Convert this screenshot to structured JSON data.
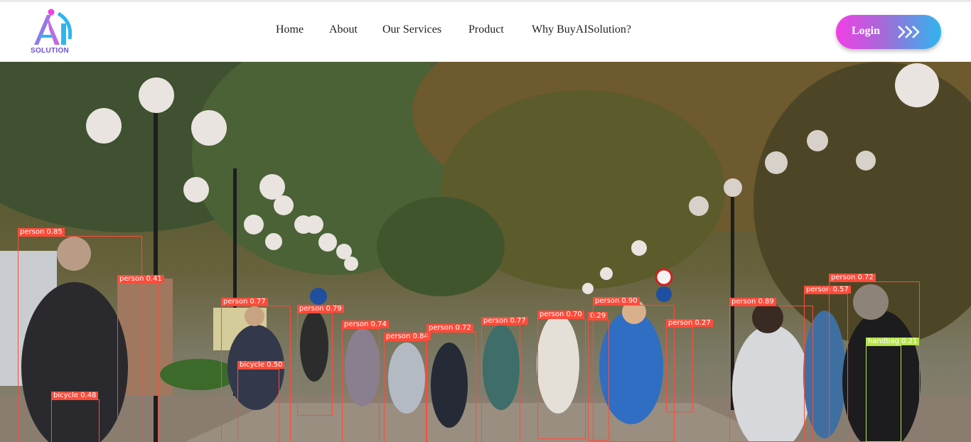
{
  "brand": {
    "logo_text": "SOLUTION"
  },
  "nav": {
    "items": [
      "Home",
      "About",
      "Our Services",
      "Product",
      "Why BuyAISolution?"
    ]
  },
  "login": {
    "label": "Login",
    "icon": "double-chevron-right-icon"
  },
  "hero": {
    "detections": [
      {
        "label": "person 0.85"
      },
      {
        "label": "person 0.41"
      },
      {
        "label": "bicycle 0.48"
      },
      {
        "label": "person 0.77"
      },
      {
        "label": "bicycle 0.50"
      },
      {
        "label": "person 0.79"
      },
      {
        "label": "person 0.74"
      },
      {
        "label": "person 0.84"
      },
      {
        "label": "person 0.72"
      },
      {
        "label": "person 0.77"
      },
      {
        "label": "person 0.70"
      },
      {
        "label": "0.29"
      },
      {
        "label": "person 0.90"
      },
      {
        "label": "person 0.27"
      },
      {
        "label": "person 0.89"
      },
      {
        "label": "person 0.57"
      },
      {
        "label": "person 0.72"
      },
      {
        "label": "handbag 0.21"
      }
    ]
  },
  "colors": {
    "accent_pink": "#f13fe6",
    "accent_blue": "#2fb5ee",
    "detection_box": "#ff4b3a",
    "detection_box_handbag": "#b6e34a"
  }
}
